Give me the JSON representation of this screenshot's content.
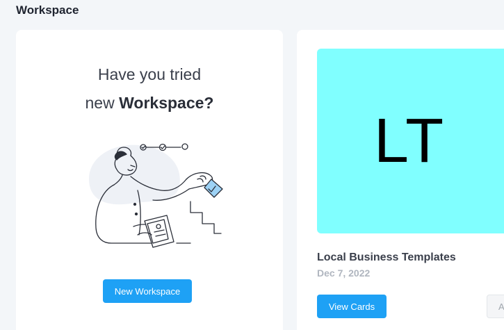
{
  "header": {
    "title": "Workspace"
  },
  "promo": {
    "line1": "Have you tried",
    "line2_prefix": "new ",
    "line2_bold": "Workspace?",
    "button_label": "New Workspace"
  },
  "template_card": {
    "thumbnail_text": "LT",
    "thumbnail_color": "#80ffff",
    "title": "Local Business Templates",
    "date": "Dec 7, 2022",
    "primary_button_label": "View Cards",
    "secondary_button_label": "A"
  },
  "colors": {
    "accent": "#1ea1f5",
    "background": "#f3f6f9"
  }
}
